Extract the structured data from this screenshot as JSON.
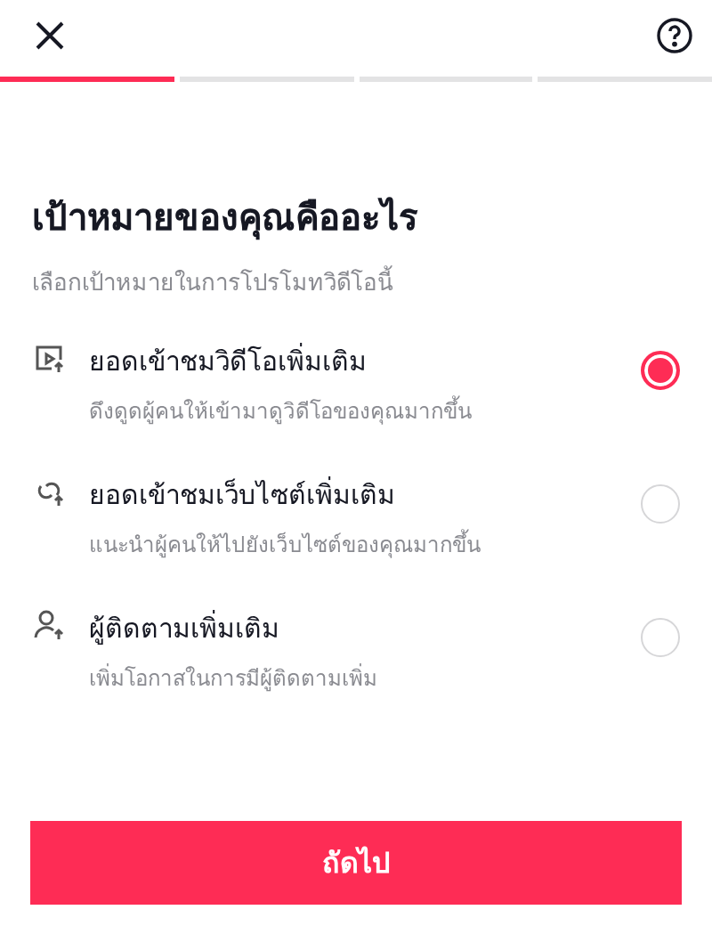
{
  "progress": [
    {
      "done": true
    },
    {
      "done": false
    },
    {
      "done": false
    },
    {
      "done": false
    }
  ],
  "title": "เป้าหมายของคุณคืออะไร",
  "subtitle": "เลือกเป้าหมายในการโปรโมทวิดีโอนี้",
  "options": [
    {
      "kind": "video",
      "title": "ยอดเข้าชมวิดีโอเพิ่มเติม",
      "description": "ดึงดูดผู้คนให้เข้ามาดูวิดีโอของคุณมากขึ้น",
      "selected": true
    },
    {
      "kind": "website",
      "title": "ยอดเข้าชมเว็บไซต์เพิ่มเติม",
      "description": "แนะนำผู้คนให้ไปยังเว็บไซต์ของคุณมากขึ้น",
      "selected": false
    },
    {
      "kind": "followers",
      "title": "ผู้ติดตามเพิ่มเติม",
      "description": "เพิ่มโอกาสในการมีผู้ติดตามเพิ่ม",
      "selected": false
    }
  ],
  "next_button": "ถัดไป"
}
